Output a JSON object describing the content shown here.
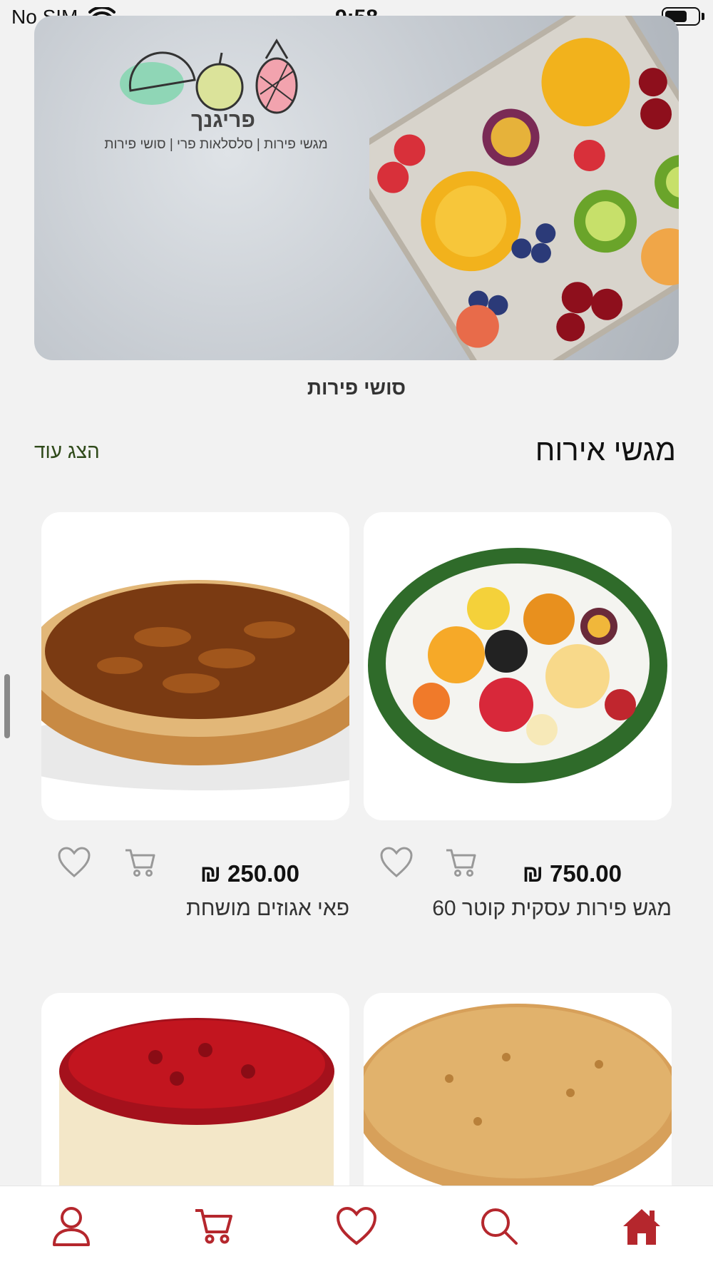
{
  "status_bar": {
    "carrier": "No SIM",
    "time": "9:58"
  },
  "banner": {
    "brand_name": "פריגנך",
    "tagline": "מגשי פירות | סלסלאות פרי | סושי פירות",
    "caption": "סושי פירות"
  },
  "section": {
    "title": "מגשי אירוח",
    "show_more": "הצג עוד"
  },
  "products": [
    {
      "name": "מגש פירות עסקית קוטר 60",
      "price": "₪ 750.00",
      "image": "fruit-platter"
    },
    {
      "name": "פאי אגוזים מושחת",
      "price": "₪ 250.00",
      "image": "pecan-pie"
    },
    {
      "name": "",
      "price": "",
      "image": "crumble-cake"
    },
    {
      "name": "",
      "price": "",
      "image": "cherry-cheesecake"
    }
  ],
  "tab_bar": {
    "items": [
      "home-icon",
      "search-icon",
      "heart-icon",
      "cart-icon",
      "user-icon"
    ],
    "active": "home-icon",
    "accent_color": "#b5272d"
  },
  "colors": {
    "accent": "#b5272d",
    "link": "#2f4a1a",
    "background": "#f2f2f2"
  }
}
